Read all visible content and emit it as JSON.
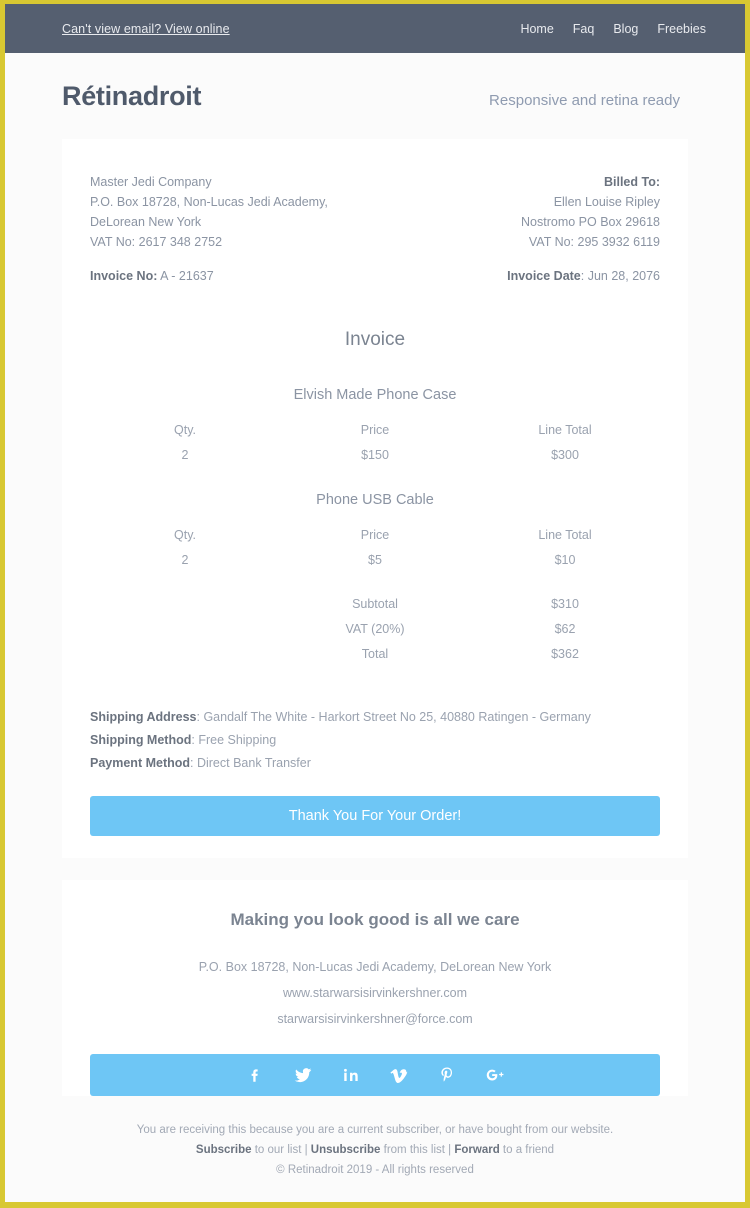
{
  "colors": {
    "page_border": "#d8c832",
    "navbar_bg": "#555f70",
    "accent_blue": "#6ec6f5",
    "body_bg": "#fbfbfb",
    "card_bg": "#ffffff",
    "muted_text": "#9aa2af",
    "strong_text": "#6b737f"
  },
  "topnav": {
    "preheader": "Can't view email? View online",
    "links": [
      {
        "label": "Home"
      },
      {
        "label": "Faq"
      },
      {
        "label": "Blog"
      },
      {
        "label": "Freebies"
      }
    ]
  },
  "brand": {
    "name": "Rétinadroit",
    "tagline": "Responsive and retina ready"
  },
  "sender": {
    "company": "Master Jedi Company",
    "address_line1": "P.O. Box 18728, Non-Lucas Jedi Academy,",
    "address_line2": "DeLorean New York",
    "vat": "VAT No: 2617 348 2752",
    "invoice_no_label": "Invoice No:",
    "invoice_no_value": "A - 21637"
  },
  "billed_to": {
    "heading": "Billed To:",
    "name": "Ellen Louise Ripley",
    "address": "Nostromo PO Box 29618",
    "vat": "VAT No: 295 3932 6119",
    "invoice_date_label": "Invoice Date",
    "invoice_date_value": ": Jun 28, 2076"
  },
  "invoice": {
    "title": "Invoice",
    "columns": [
      "Qty.",
      "Price",
      "Line Total"
    ],
    "items": [
      {
        "name": "Elvish Made Phone Case",
        "qty": "2",
        "price": "$150",
        "line_total": "$300"
      },
      {
        "name": "Phone USB Cable",
        "qty": "2",
        "price": "$5",
        "line_total": "$10"
      }
    ],
    "totals": [
      {
        "label": "Subtotal",
        "value": "$310"
      },
      {
        "label": "VAT (20%)",
        "value": "$62"
      },
      {
        "label": "Total",
        "value": "$362"
      }
    ]
  },
  "meta": {
    "shipping_address_label": "Shipping Address",
    "shipping_address_value": ": Gandalf The White - Harkort Street No 25, 40880 Ratingen - Germany",
    "shipping_method_label": "Shipping Method",
    "shipping_method_value": ": Free Shipping",
    "payment_method_label": "Payment Method",
    "payment_method_value": ": Direct Bank Transfer"
  },
  "cta": {
    "label": "Thank You For Your Order!"
  },
  "footer": {
    "headline": "Making you look good is all we care",
    "address": "P.O. Box 18728, Non-Lucas Jedi Academy, DeLorean New York",
    "website": "www.starwarsisirvinkershner.com",
    "email": "starwarsisirvinkershner@force.com",
    "social": [
      {
        "name": "facebook-icon"
      },
      {
        "name": "twitter-icon"
      },
      {
        "name": "linkedin-icon"
      },
      {
        "name": "vimeo-icon"
      },
      {
        "name": "pinterest-icon"
      },
      {
        "name": "google-plus-icon"
      }
    ]
  },
  "legal": {
    "line1": "You are receiving this because you are a current subscriber, or have bought from our website.",
    "subscribe": "Subscribe",
    "subscribe_tail": " to our list | ",
    "unsubscribe": "Unsubscribe",
    "unsubscribe_tail": " from this list | ",
    "forward": "Forward",
    "forward_tail": " to a friend",
    "copyright": "© Retinadroit 2019 - All rights reserved"
  }
}
